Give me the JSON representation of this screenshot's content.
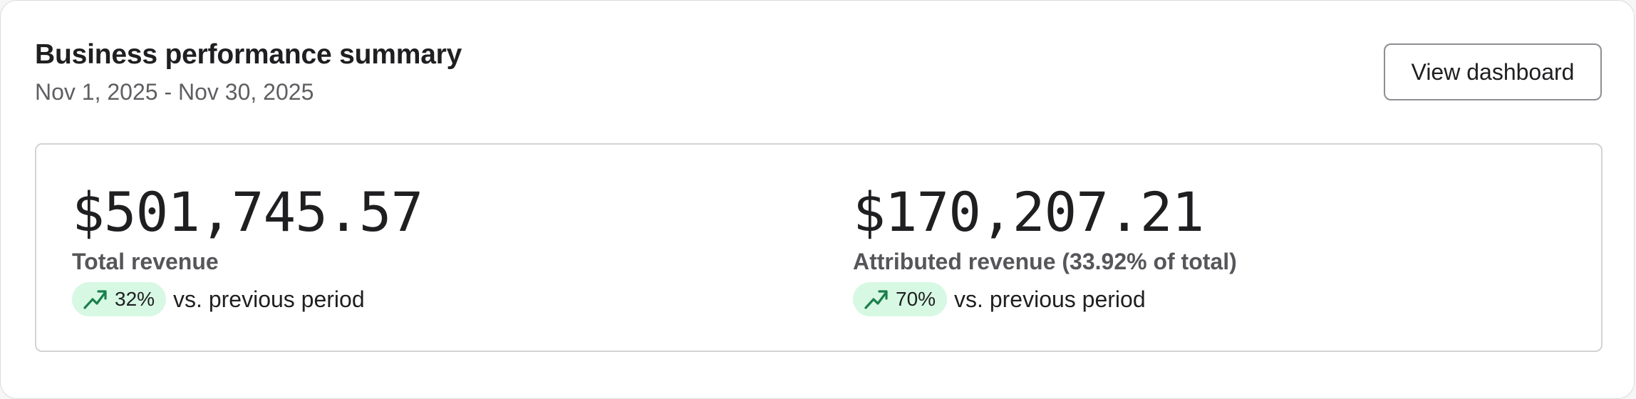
{
  "header": {
    "title": "Business performance summary",
    "date_range": "Nov 1, 2025 - Nov 30, 2025",
    "view_dashboard_label": "View dashboard"
  },
  "metrics": [
    {
      "value": "$501,745.57",
      "label": "Total revenue",
      "change": "32%",
      "change_direction": "up",
      "comparison": "vs. previous period",
      "icon": "trending-up-icon"
    },
    {
      "value": "$170,207.21",
      "label": "Attributed revenue (33.92% of total)",
      "change": "70%",
      "change_direction": "up",
      "comparison": "vs. previous period",
      "icon": "trending-up-icon"
    }
  ],
  "colors": {
    "positive_badge_bg": "#d7f8e3",
    "positive_icon": "#1a7f4b",
    "text_primary": "#1f1f21",
    "text_secondary": "#5f5f63"
  }
}
